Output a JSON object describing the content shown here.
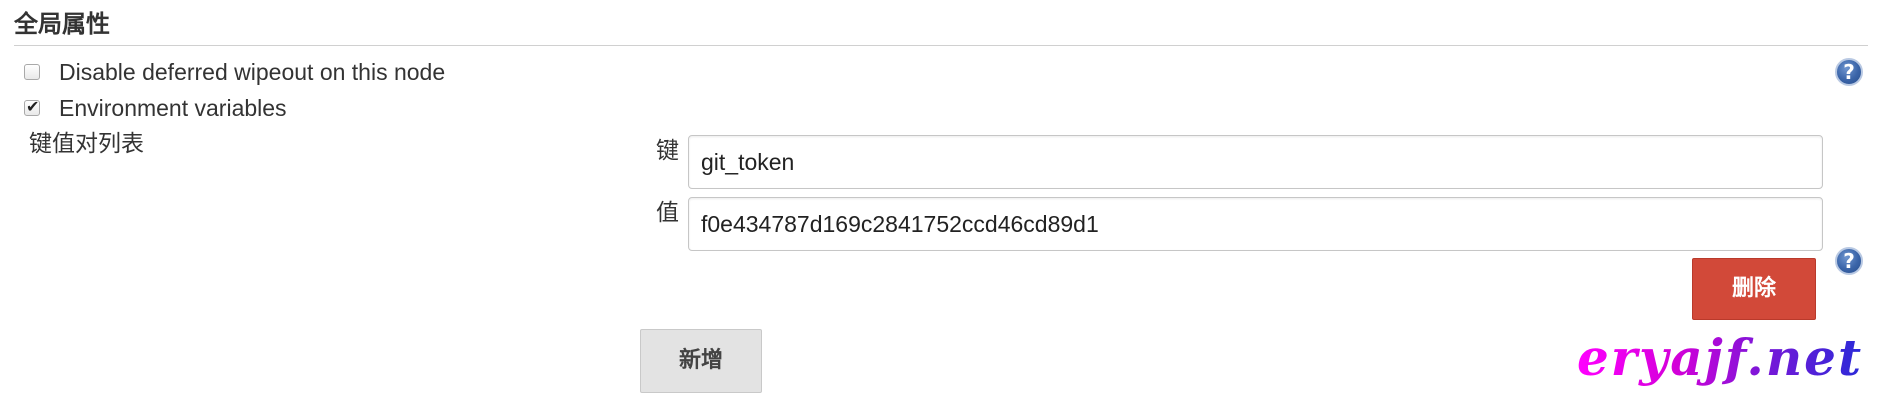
{
  "section": {
    "title": "全局属性"
  },
  "options": {
    "disable_wipeout": {
      "label": "Disable deferred wipeout on this node",
      "checked": false
    },
    "env_vars": {
      "label": "Environment variables",
      "checked": true
    }
  },
  "kv": {
    "list_label": "键值对列表",
    "key_label": "键",
    "key_value": "git_token",
    "value_label": "值",
    "value_value": "f0e434787d169c2841752ccd46cd89d1",
    "delete_label": "删除"
  },
  "actions": {
    "add_label": "新增"
  },
  "help": {
    "glyph": "?"
  },
  "watermark": {
    "text": "eryajf.net"
  },
  "icons": {
    "help": "help-icon",
    "check": "checkmark-icon"
  },
  "colors": {
    "delete_button": "#d24939",
    "add_button": "#e3e3e3",
    "help_icon": "#3a64a8",
    "watermark_start": "#ff00ff",
    "watermark_end": "#2a2ad8"
  }
}
